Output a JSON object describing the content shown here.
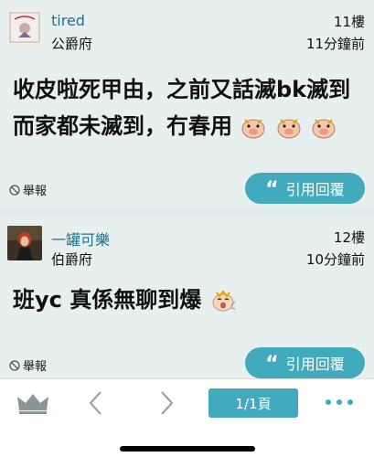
{
  "posts": [
    {
      "username": "tired",
      "rank": "公爵府",
      "floor": "11樓",
      "time": "11分鐘前",
      "content": "收皮啦死甲由，之前又話滅bk滅到而家都未滅到，冇春用",
      "report_label": "舉報",
      "reply_label": "引用回覆",
      "emoji": [
        "pig-emoji",
        "pig-emoji",
        "pig-emoji"
      ]
    },
    {
      "username": "一罐可樂",
      "rank": "伯爵府",
      "floor": "12樓",
      "time": "10分鐘前",
      "content": "班yc 真係無聊到爆",
      "report_label": "舉報",
      "reply_label": "引用回覆",
      "emoji": [
        "yawn-emoji"
      ]
    }
  ],
  "bottom_bar": {
    "page_label": "1/1頁"
  },
  "colors": {
    "accent": "#41aabc",
    "username": "#1f6f88",
    "post_bg": "#e7f0ef"
  }
}
